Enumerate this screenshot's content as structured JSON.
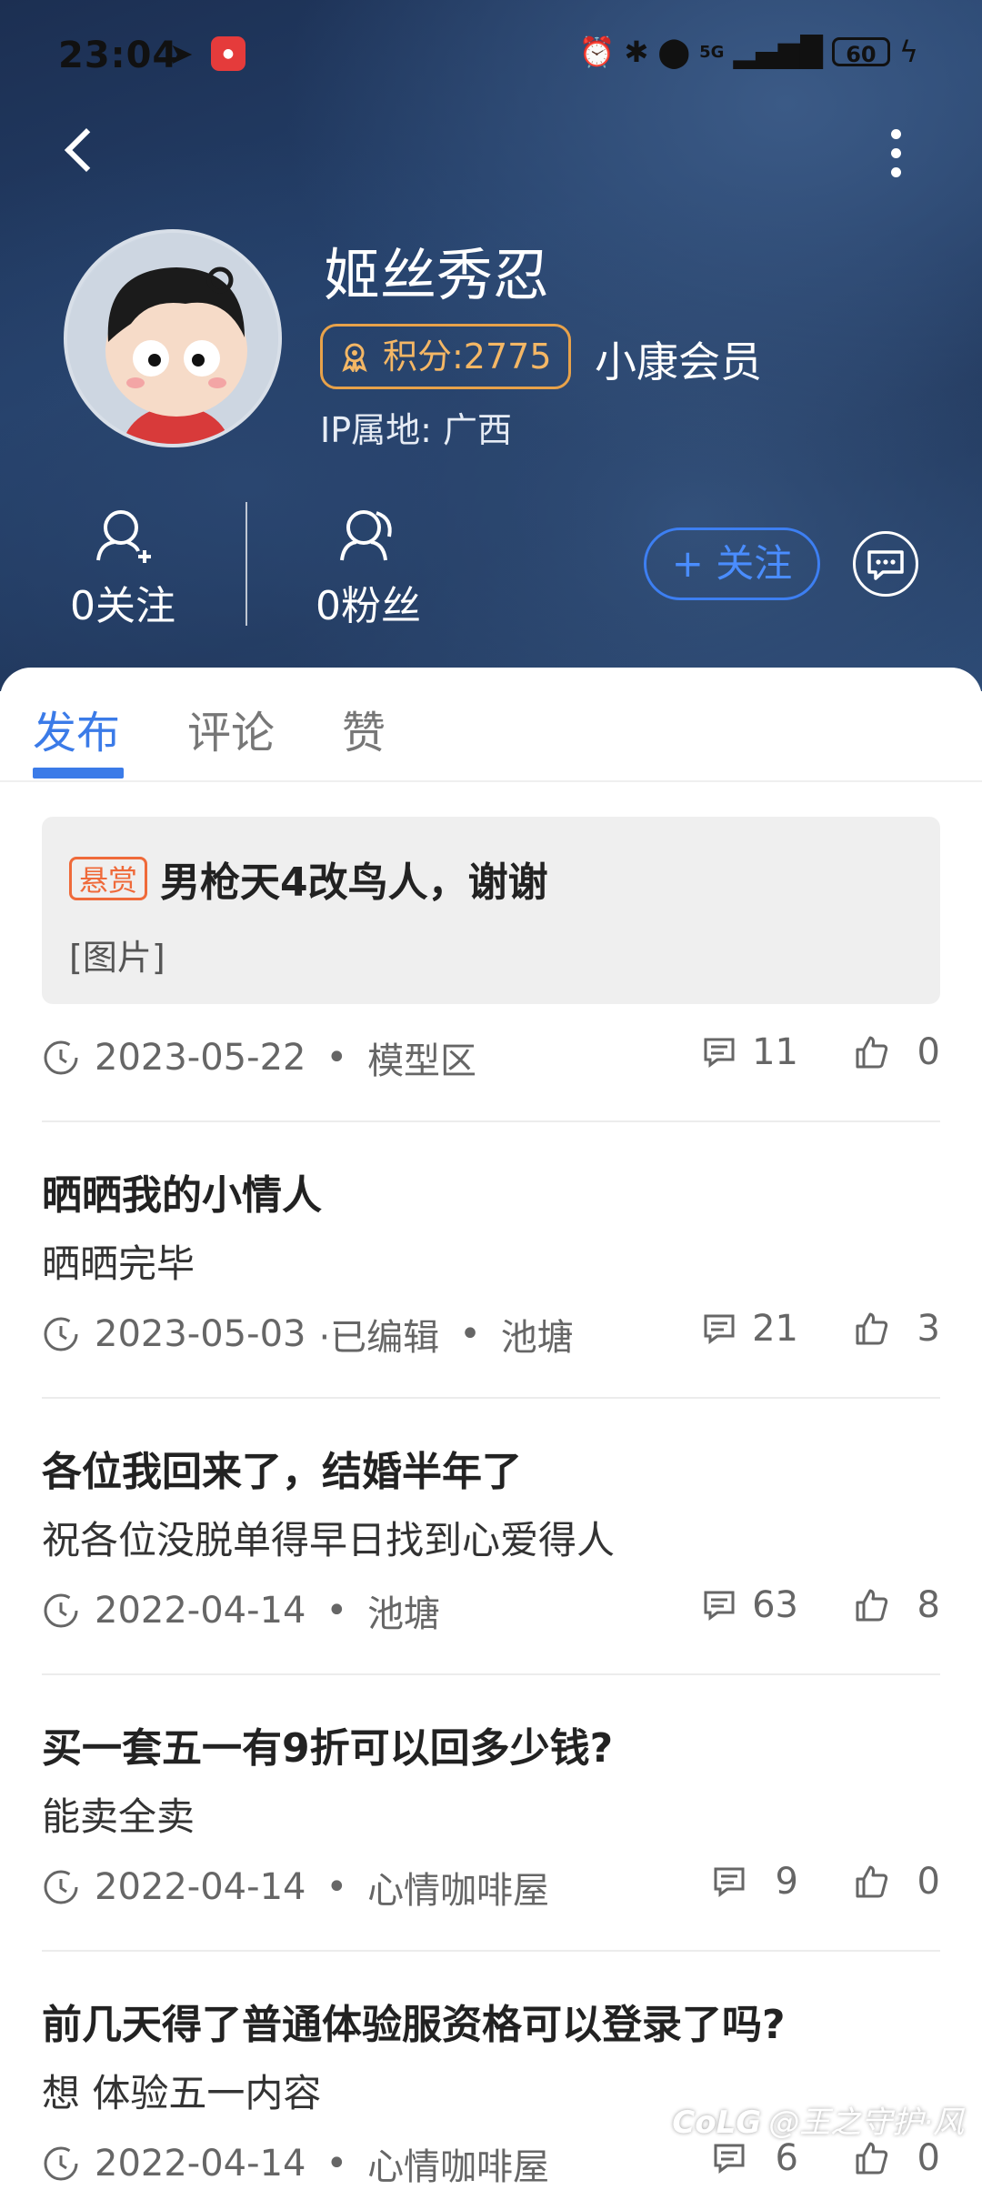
{
  "status_bar": {
    "time": "23:04",
    "battery": "60",
    "network": "5G",
    "icons": [
      "alarm-icon",
      "bluetooth-icon",
      "location-icon",
      "signal-icon",
      "charging-icon"
    ]
  },
  "profile": {
    "name": "姬丝秀忍",
    "points_label": "积分:2775",
    "member_label": "小康会员",
    "ip_label": "IP属地: 广西",
    "following_label": "0关注",
    "fans_label": "0粉丝",
    "follow_button": "+ 关注"
  },
  "colors": {
    "accent": "#3b7be8",
    "bounty": "#ef6a3a",
    "points": "#e8a24a"
  },
  "tabs": [
    {
      "label": "发布",
      "active": true
    },
    {
      "label": "评论",
      "active": false
    },
    {
      "label": "赞",
      "active": false
    }
  ],
  "posts": [
    {
      "tag": "悬赏",
      "title": "男枪天4改鸟人，谢谢",
      "body": "[图片]",
      "date": "2023-05-22",
      "edited": "",
      "board": "模型区",
      "comments": "11",
      "likes": "0"
    },
    {
      "tag": "",
      "title": "晒晒我的小情人",
      "body": " 晒晒完毕",
      "date": "2023-05-03",
      "edited": "·已编辑",
      "board": "池塘",
      "comments": "21",
      "likes": "3"
    },
    {
      "tag": "",
      "title": "各位我回来了，结婚半年了",
      "body": "祝各位没脱单得早日找到心爱得人",
      "date": "2022-04-14",
      "edited": "",
      "board": "池塘",
      "comments": "63",
      "likes": "8"
    },
    {
      "tag": "",
      "title": "买一套五一有9折可以回多少钱?",
      "body": "能卖全卖",
      "date": "2022-04-14",
      "edited": "",
      "board": "心情咖啡屋",
      "comments": "9",
      "likes": "0"
    },
    {
      "tag": "",
      "title": "前几天得了普通体验服资格可以登录了吗?",
      "body": "想 体验五一内容",
      "date": "2022-04-14",
      "edited": "",
      "board": "心情咖啡屋",
      "comments": "6",
      "likes": "0"
    }
  ],
  "separator": "•",
  "watermark": "@王之守护·风",
  "watermark_logo": "CoLG"
}
